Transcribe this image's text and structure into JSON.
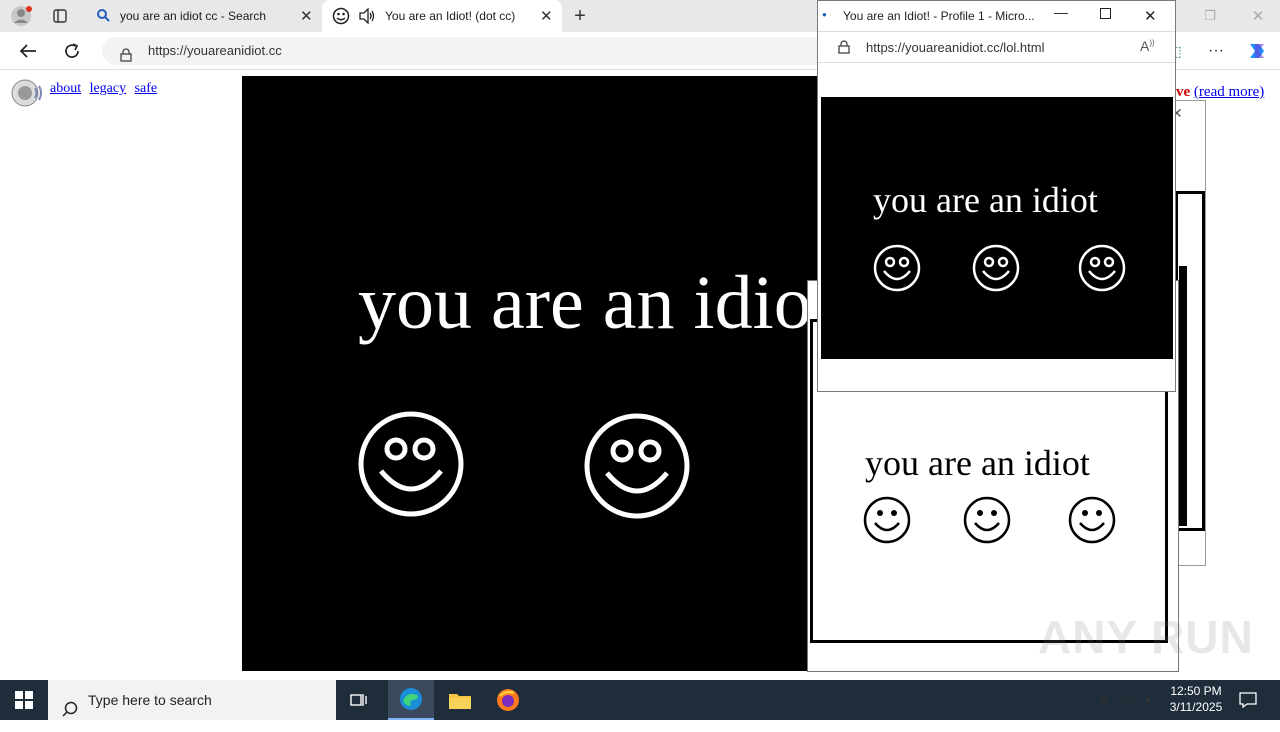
{
  "browser": {
    "tabs": [
      {
        "title": "you are an idiot cc - Search",
        "icon": "search-icon"
      },
      {
        "title": "You are an Idiot! (dot cc)",
        "icon": "smiley-icon",
        "active": true
      }
    ],
    "url": "https://youareanidiot.cc"
  },
  "page": {
    "links": [
      "about",
      "legacy",
      "safe"
    ],
    "right_link_partial": "ve",
    "read_more": "(read more)",
    "headline": "you are an idiot"
  },
  "popup_front": {
    "title": "You are an Idiot! - Profile 1 - Micro...",
    "url": "https://youareanidiot.cc/lol.html",
    "headline": "you are an idiot"
  },
  "popup_back": {
    "headline": "you are an idiot"
  },
  "watermark": "ANY RUN",
  "taskbar": {
    "search_placeholder": "Type here to search",
    "time": "12:50 PM",
    "date": "3/11/2025"
  },
  "colors": {
    "accent_red": "#cc0000",
    "link_blue": "#0000ee",
    "taskbar": "#1f2c3a"
  }
}
